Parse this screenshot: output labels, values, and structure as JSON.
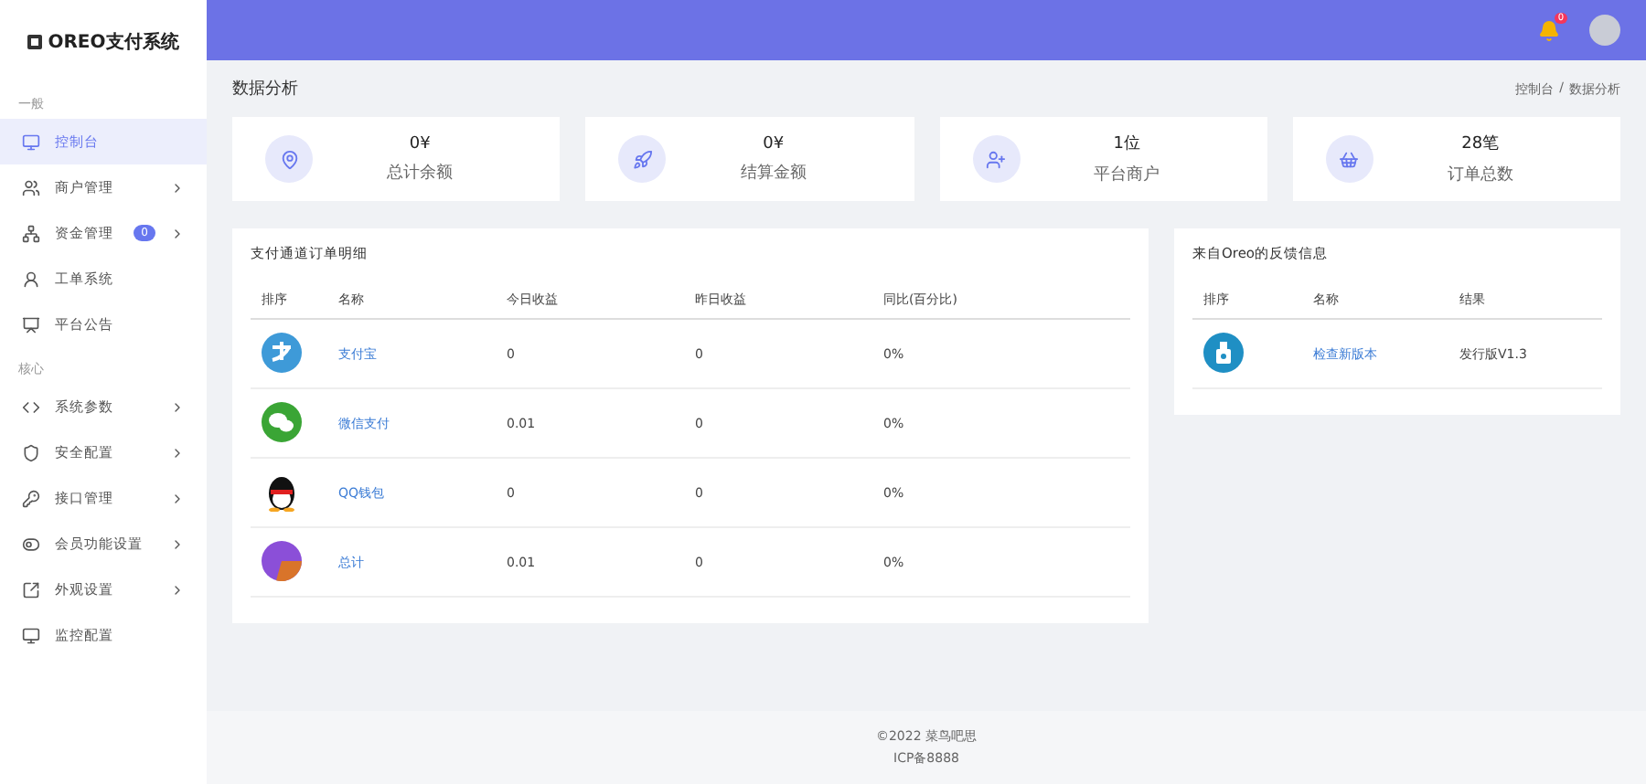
{
  "brand": "OREO支付系统",
  "sidebar": [
    {
      "kind": "section",
      "label": "一般"
    },
    {
      "kind": "item",
      "label": "控制台",
      "selected": true,
      "expandable": false
    },
    {
      "kind": "item",
      "label": "商户管理",
      "selected": false,
      "expandable": true
    },
    {
      "kind": "item",
      "label": "资金管理",
      "selected": false,
      "expandable": true,
      "badge": "0"
    },
    {
      "kind": "item",
      "label": "工单系统",
      "selected": false,
      "expandable": false
    },
    {
      "kind": "item",
      "label": "平台公告",
      "selected": false,
      "expandable": false
    },
    {
      "kind": "section",
      "label": "核心"
    },
    {
      "kind": "item",
      "label": "系统参数",
      "selected": false,
      "expandable": true
    },
    {
      "kind": "item",
      "label": "安全配置",
      "selected": false,
      "expandable": true
    },
    {
      "kind": "item",
      "label": "接口管理",
      "selected": false,
      "expandable": true
    },
    {
      "kind": "item",
      "label": "会员功能设置",
      "selected": false,
      "expandable": true
    },
    {
      "kind": "item",
      "label": "外观设置",
      "selected": false,
      "expandable": true
    },
    {
      "kind": "item",
      "label": "监控配置",
      "selected": false,
      "expandable": false
    }
  ],
  "header": {
    "notification_badge": "0"
  },
  "page_title": "数据分析",
  "breadcrumb": [
    "控制台",
    "数据分析"
  ],
  "breadcrumb_separator": "/",
  "stats": [
    {
      "value": "0¥",
      "label": "总计余额"
    },
    {
      "value": "0¥",
      "label": "结算金额"
    },
    {
      "value": "1位",
      "label": "平台商户"
    },
    {
      "value": "28笔",
      "label": "订单总数"
    }
  ],
  "channels": {
    "title": "支付通道订单明细",
    "columns": [
      "排序",
      "名称",
      "今日收益",
      "昨日收益",
      "同比(百分比)"
    ],
    "rows": [
      {
        "kind": "alipay",
        "name": "支付宝",
        "today": "0",
        "yesterday": "0",
        "ratio": "0%"
      },
      {
        "kind": "wechat",
        "name": "微信支付",
        "today": "0.01",
        "yesterday": "0",
        "ratio": "0%"
      },
      {
        "kind": "qq",
        "name": "QQ钱包",
        "today": "0",
        "yesterday": "0",
        "ratio": "0%"
      },
      {
        "kind": "total",
        "name": "总计",
        "today": "0.01",
        "yesterday": "0",
        "ratio": "0%"
      }
    ]
  },
  "feedback": {
    "title": "来自Oreo的反馈信息",
    "columns": [
      "排序",
      "名称",
      "结果"
    ],
    "rows": [
      {
        "name": "检查新版本",
        "result": "发行版V1.3"
      }
    ]
  },
  "footer": [
    "©2022 菜鸟吧思",
    "ICP备8888"
  ]
}
